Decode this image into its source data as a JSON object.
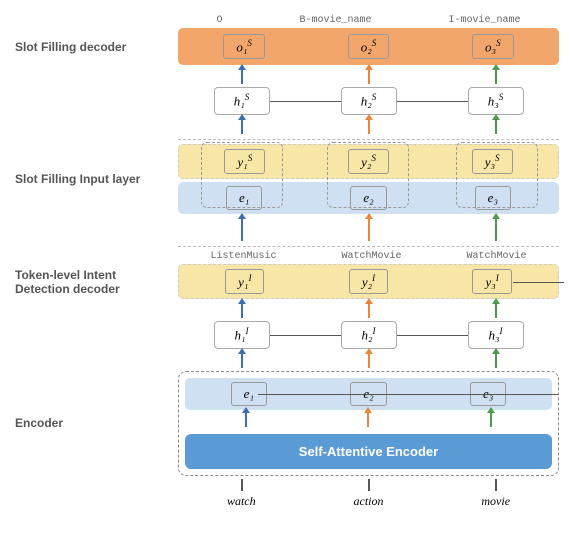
{
  "sections": {
    "slot_filling_decoder": "Slot Filling decoder",
    "slot_filling_input": "Slot Filling Input layer",
    "token_intent": "Token-level Intent Detection decoder",
    "encoder": "Encoder"
  },
  "top_tags": [
    "O",
    "B-movie_name",
    "I-movie_name"
  ],
  "slot_outputs": [
    "o₁",
    "o₂",
    "o₃"
  ],
  "slot_out_sup": "S",
  "h_slot": [
    "h₁",
    "h₂",
    "h₃"
  ],
  "h_slot_sup": "S",
  "y_slot": [
    "y₁",
    "y₂",
    "y₃"
  ],
  "y_slot_sup": "S",
  "e_vals": [
    "e₁",
    "e₂",
    "e₃"
  ],
  "intent_labels": [
    "ListenMusic",
    "WatchMovie",
    "WatchMovie"
  ],
  "y_intent": [
    "y₁",
    "y₂",
    "y₃"
  ],
  "y_intent_sup": "I",
  "h_intent": [
    "h₁",
    "h₂",
    "h₃"
  ],
  "h_intent_sup": "I",
  "encoder_name": "Self-Attentive Encoder",
  "input_words": [
    "watch",
    "action",
    "movie"
  ],
  "chart_data": {
    "type": "diagram",
    "title": "Neural architecture for joint slot filling and intent detection",
    "components": [
      {
        "name": "Encoder",
        "outputs": [
          "e1",
          "e2",
          "e3"
        ],
        "module": "Self-Attentive Encoder",
        "inputs": [
          "watch",
          "action",
          "movie"
        ]
      },
      {
        "name": "Token-level Intent Detection decoder",
        "hidden": [
          "h1_I",
          "h2_I",
          "h3_I"
        ],
        "outputs": [
          "y1_I",
          "y2_I",
          "y3_I"
        ],
        "predictions": [
          "ListenMusic",
          "WatchMovie",
          "WatchMovie"
        ]
      },
      {
        "name": "Slot Filling Input layer",
        "concat_of": [
          "y_I",
          "e"
        ]
      },
      {
        "name": "Slot Filling decoder",
        "hidden": [
          "h1_S",
          "h2_S",
          "h3_S"
        ],
        "outputs": [
          "o1_S",
          "o2_S",
          "o3_S"
        ],
        "predictions": [
          "O",
          "B-movie_name",
          "I-movie_name"
        ]
      }
    ],
    "flow": "Encoder -> Intent decoder -> (concat with e) -> Slot Filling decoder"
  }
}
